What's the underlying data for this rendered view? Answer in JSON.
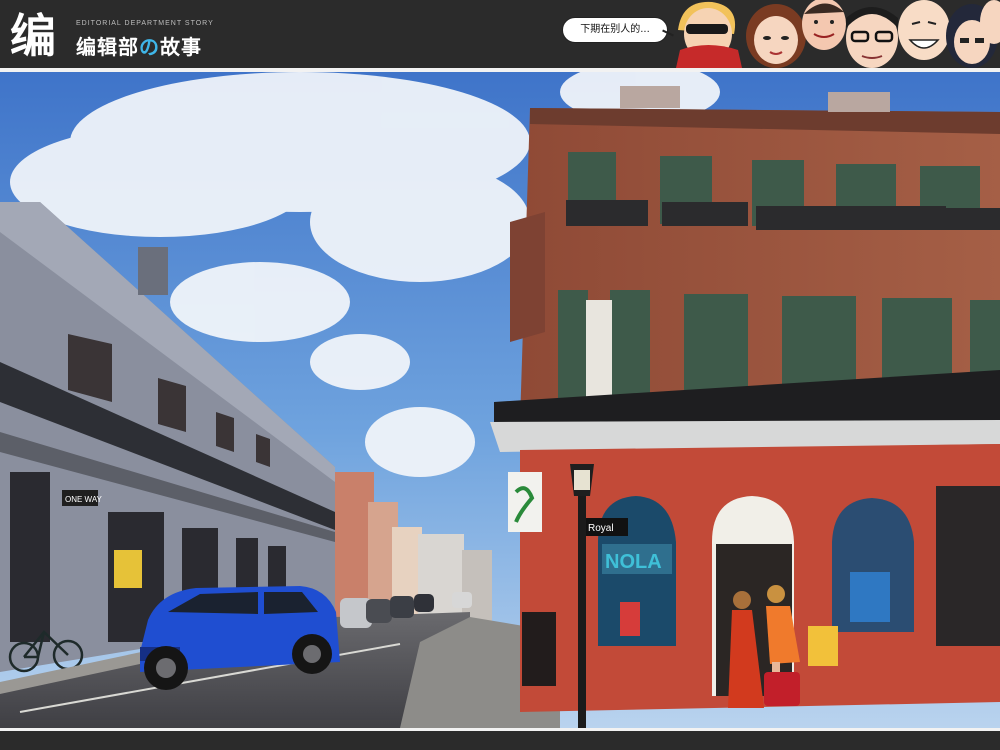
{
  "header": {
    "logo_mark": "编",
    "logo_en": "EDITORIAL DEPARTMENT STORY",
    "logo_cn_before": "编辑部",
    "logo_cn_no": "の",
    "logo_cn_after": "故事",
    "bubble_text": "下期在别人的..."
  },
  "photo": {
    "sign_oneway": "ONE WAY",
    "sign_royal": "Royal",
    "shop_sign": "NOLA"
  },
  "colors": {
    "header_bg": "#2b2b2b",
    "accent_blue": "#3fb6e8",
    "brick": "#b5533a",
    "sky": "#5f93d6"
  }
}
